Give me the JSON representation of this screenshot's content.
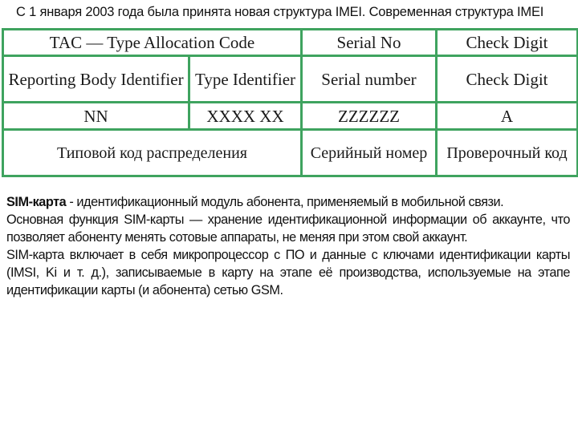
{
  "intro": {
    "text": "С 1 января 2003 года была принята новая структура IMEI. Современная структура IMEI"
  },
  "imei_table": {
    "row_header": {
      "tac": "TAC — Type Allocation Code",
      "serial": "Serial No",
      "check": "Check Digit"
    },
    "row_subheader": {
      "reporting_body": "Reporting Body Identifier",
      "type_identifier": "Type Identifier",
      "serial": "Serial number",
      "check": "Check Digit"
    },
    "row_format": {
      "reporting_body": "NN",
      "type_identifier": "XXXX XX",
      "serial": "ZZZZZZ",
      "check": "A"
    },
    "row_russian": {
      "tac": "Типовой код распределения",
      "serial": "Серийный номер",
      "check": "Проверочный код"
    },
    "border_color": "#3fa35f"
  },
  "body": {
    "p1_bold": "SIM-карта",
    "p1_rest": " - идентификационный модуль абонента, применяемый в мобильной связи.",
    "p2": "Основная функция SIM-карты — хранение идентификационной информации об аккаунте, что позволяет абоненту менять сотовые аппараты, не меняя при этом свой аккаунт.",
    "p3": "SIM-карта включает в себя микропроцессор с ПО и данные с ключами идентификации карты (IMSI, Ki и т. д.), записываемые в карту на этапе её производства, используемые на этапе идентификации карты (и абонента) сетью GSM."
  }
}
